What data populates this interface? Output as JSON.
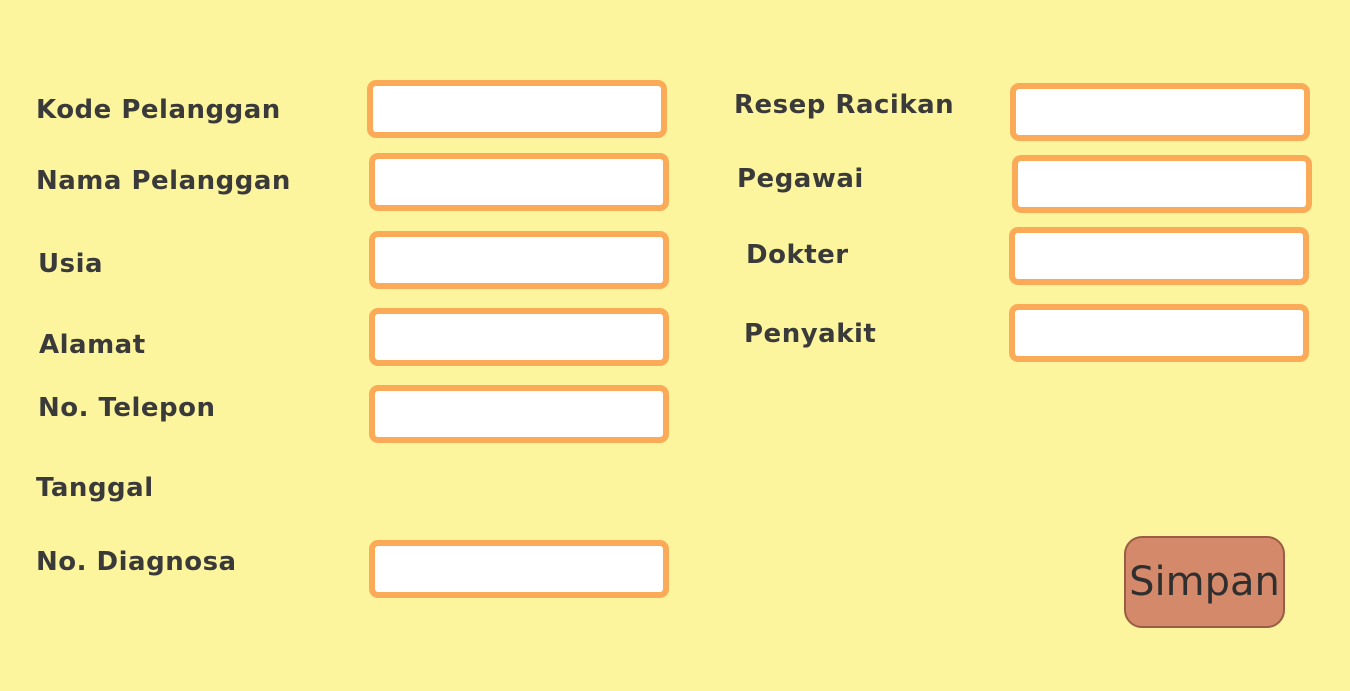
{
  "form": {
    "left": {
      "kode_pelanggan": {
        "label": "Kode Pelanggan",
        "value": "",
        "placeholder": ""
      },
      "nama_pelanggan": {
        "label": "Nama Pelanggan",
        "value": "",
        "placeholder": ""
      },
      "usia": {
        "label": "Usia",
        "value": "",
        "placeholder": ""
      },
      "alamat": {
        "label": "Alamat",
        "value": "",
        "placeholder": ""
      },
      "no_telepon": {
        "label": "No. Telepon",
        "value": "",
        "placeholder": ""
      },
      "tanggal": {
        "label": "Tanggal"
      },
      "no_diagnosa": {
        "label": "No. Diagnosa",
        "value": "",
        "placeholder": ""
      }
    },
    "right": {
      "resep_racikan": {
        "label": "Resep Racikan",
        "value": "",
        "placeholder": ""
      },
      "pegawai": {
        "label": "Pegawai",
        "value": "",
        "placeholder": ""
      },
      "dokter": {
        "label": "Dokter",
        "value": "",
        "placeholder": ""
      },
      "penyakit": {
        "label": "Penyakit",
        "value": "",
        "placeholder": ""
      }
    },
    "submit_label": "Simpan"
  },
  "colors": {
    "background": "#fdf59e",
    "field_border": "#fbab58",
    "button_fill": "#d4896a",
    "text": "#3a3a3a"
  }
}
